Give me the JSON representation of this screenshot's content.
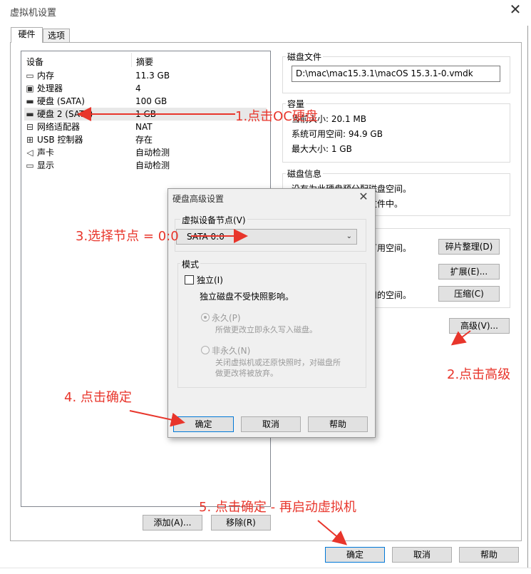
{
  "window": {
    "title": "虚拟机设置",
    "close_glyph": "✕"
  },
  "tabs": [
    {
      "label": "硬件"
    },
    {
      "label": "选项"
    }
  ],
  "device_list": {
    "headers": {
      "device": "设备",
      "summary": "摘要"
    },
    "rows": [
      {
        "name": "内存",
        "value": "11.3 GB",
        "icon": "memory-icon",
        "glyph": "▭"
      },
      {
        "name": "处理器",
        "value": "4",
        "icon": "cpu-icon",
        "glyph": "▣"
      },
      {
        "name": "硬盘 (SATA)",
        "value": "100 GB",
        "icon": "hard-disk-icon",
        "glyph": "▬"
      },
      {
        "name": "硬盘 2 (SATA)",
        "value": "1 GB",
        "icon": "hard-disk-icon",
        "glyph": "▬"
      },
      {
        "name": "网络适配器",
        "value": "NAT",
        "icon": "network-adapter-icon",
        "glyph": "⊟"
      },
      {
        "name": "USB 控制器",
        "value": "存在",
        "icon": "usb-icon",
        "glyph": "⊞"
      },
      {
        "name": "声卡",
        "value": "自动检测",
        "icon": "speaker-icon",
        "glyph": "◁"
      },
      {
        "name": "显示",
        "value": "自动检测",
        "icon": "monitor-icon",
        "glyph": "▭"
      }
    ],
    "add_button": "添加(A)...",
    "remove_button": "移除(R)"
  },
  "disk_file": {
    "title": "磁盘文件",
    "path": "D:\\mac\\mac15.3.1\\macOS 15.3.1-0.vmdk"
  },
  "capacity": {
    "title": "容量",
    "current_size": "当前大小: 20.1 MB",
    "system_free": "系统可用空间: 94.9 GB",
    "max_size": "最大大小: 1 GB"
  },
  "disk_info": {
    "title": "磁盘信息",
    "line1": "没有为此硬盘预分配磁盘空间。",
    "line2": "硬盘内容存储在单个文件中。"
  },
  "utilities": {
    "defrag_desc": "整理文件碎片并合并可用空间。",
    "defrag_button": "碎片整理(D)",
    "expand_button": "扩展(E)...",
    "compact_desc": "压缩磁盘以回收未使用的空间。",
    "compact_button": "压缩(C)",
    "advanced_button": "高级(V)..."
  },
  "advanced_dialog": {
    "title": "硬盘高级设置",
    "close_glyph": "✕",
    "node_group": "虚拟设备节点(V)",
    "node_value": "SATA 0:0",
    "mode_group": "模式",
    "independent_label": "独立(I)",
    "independent_desc": "独立磁盘不受快照影响。",
    "persistent_label": "永久(P)",
    "persistent_desc": "所做更改立即永久写入磁盘。",
    "nonpersistent_label": "非永久(N)",
    "nonpersistent_desc1": "关闭虚拟机或还原快照时，对磁盘所",
    "nonpersistent_desc2": "做更改将被放弃。",
    "ok": "确定",
    "cancel": "取消",
    "help": "帮助"
  },
  "footer": {
    "ok": "确定",
    "cancel": "取消",
    "help": "帮助"
  },
  "annotations": {
    "step1": "1.点击OC硬盘",
    "step2": "2.点击高级",
    "step3": "3.选择节点 = 0:0",
    "step4": "4. 点击确定",
    "step5": "5. 点击确定 - 再启动虚拟机",
    "color": "#e8352b"
  },
  "colors": {
    "accent": "#0078d7",
    "annotation": "#e8352b"
  }
}
